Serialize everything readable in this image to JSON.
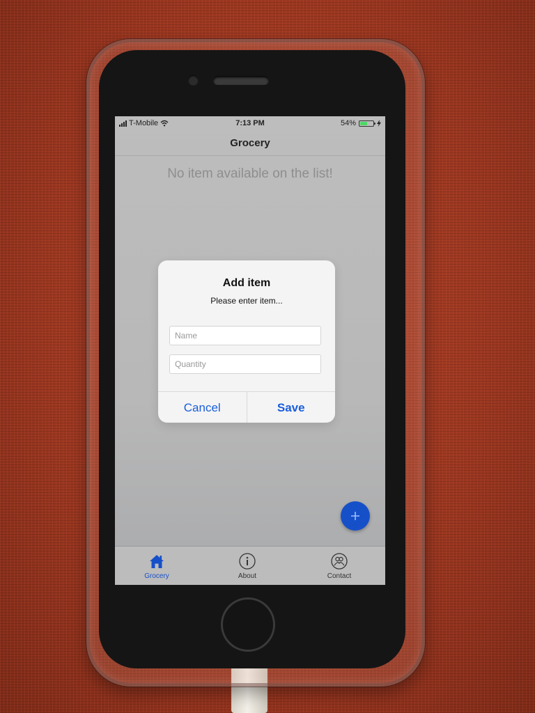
{
  "status_bar": {
    "carrier": "T-Mobile",
    "time": "7:13 PM",
    "battery_percent": "54%",
    "battery_level": 0.54,
    "icons": [
      "signal-bars-icon",
      "wifi-icon",
      "battery-icon",
      "charging-bolt-icon"
    ]
  },
  "nav": {
    "title": "Grocery"
  },
  "list": {
    "empty_message": "No item available on the list!"
  },
  "fab": {
    "icon": "plus-icon",
    "color": "#1650c9"
  },
  "dialog": {
    "title": "Add item",
    "message": "Please enter item...",
    "name_placeholder": "Name",
    "name_value": "",
    "quantity_placeholder": "Quantity",
    "quantity_value": "",
    "cancel_label": "Cancel",
    "save_label": "Save",
    "button_color": "#1a5edb"
  },
  "tabs": [
    {
      "label": "Grocery",
      "icon": "home-icon",
      "active": true
    },
    {
      "label": "About",
      "icon": "info-icon",
      "active": false
    },
    {
      "label": "Contact",
      "icon": "contacts-icon",
      "active": false
    }
  ],
  "colors": {
    "accent": "#1650c9"
  }
}
